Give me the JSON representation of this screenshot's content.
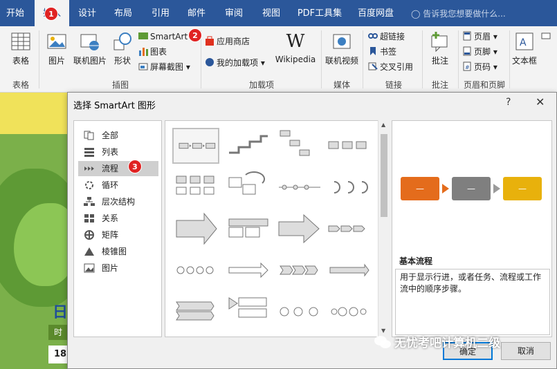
{
  "ribbon_tabs": [
    {
      "label": "开始"
    },
    {
      "label": "插入",
      "active": true
    },
    {
      "label": "设计"
    },
    {
      "label": "布局"
    },
    {
      "label": "引用"
    },
    {
      "label": "邮件"
    },
    {
      "label": "审阅"
    },
    {
      "label": "视图"
    },
    {
      "label": "PDF工具集"
    },
    {
      "label": "百度网盘"
    }
  ],
  "tell_me": "告诉我您想要做什么...",
  "ribbon": {
    "table": {
      "label": "表格",
      "group": "表格"
    },
    "picture": "图片",
    "online_picture": "联机图片",
    "shapes": "形状",
    "smartart": "SmartArt",
    "chart": "图表",
    "screenshot": "屏幕截图",
    "illustrations_group": "插图",
    "store": "应用商店",
    "my_addins": "我的加载项",
    "wikipedia": "Wikipedia",
    "addins_group": "加载项",
    "online_video": "联机视频",
    "media_group": "媒体",
    "hyperlink": "超链接",
    "bookmark": "书签",
    "cross_ref": "交叉引用",
    "links_group": "链接",
    "comment": "批注",
    "comment_group": "批注",
    "header": "页眉",
    "footer": "页脚",
    "page_number": "页码",
    "header_footer_group": "页眉和页脚",
    "textbox": "文本框"
  },
  "badges": [
    "1",
    "2",
    "3"
  ],
  "document": {
    "day_char": "日",
    "cell1": "时",
    "cell2": "18"
  },
  "dialog": {
    "title": "选择 SmartArt 图形",
    "help": "?",
    "close": "✕",
    "categories": [
      "全部",
      "列表",
      "流程",
      "循环",
      "层次结构",
      "关系",
      "矩阵",
      "棱锥图",
      "图片"
    ],
    "selected_category": "流程",
    "preview": {
      "box_label": "—",
      "name": "基本流程",
      "description": "用于显示行进，或者任务、流程或工作流中的顺序步骤。",
      "colors": [
        "#e46c1c",
        "#7f7f7f",
        "#e8b10c"
      ]
    },
    "ok": "确定",
    "cancel": "取消"
  },
  "watermark": "无忧考吧计算机二级"
}
